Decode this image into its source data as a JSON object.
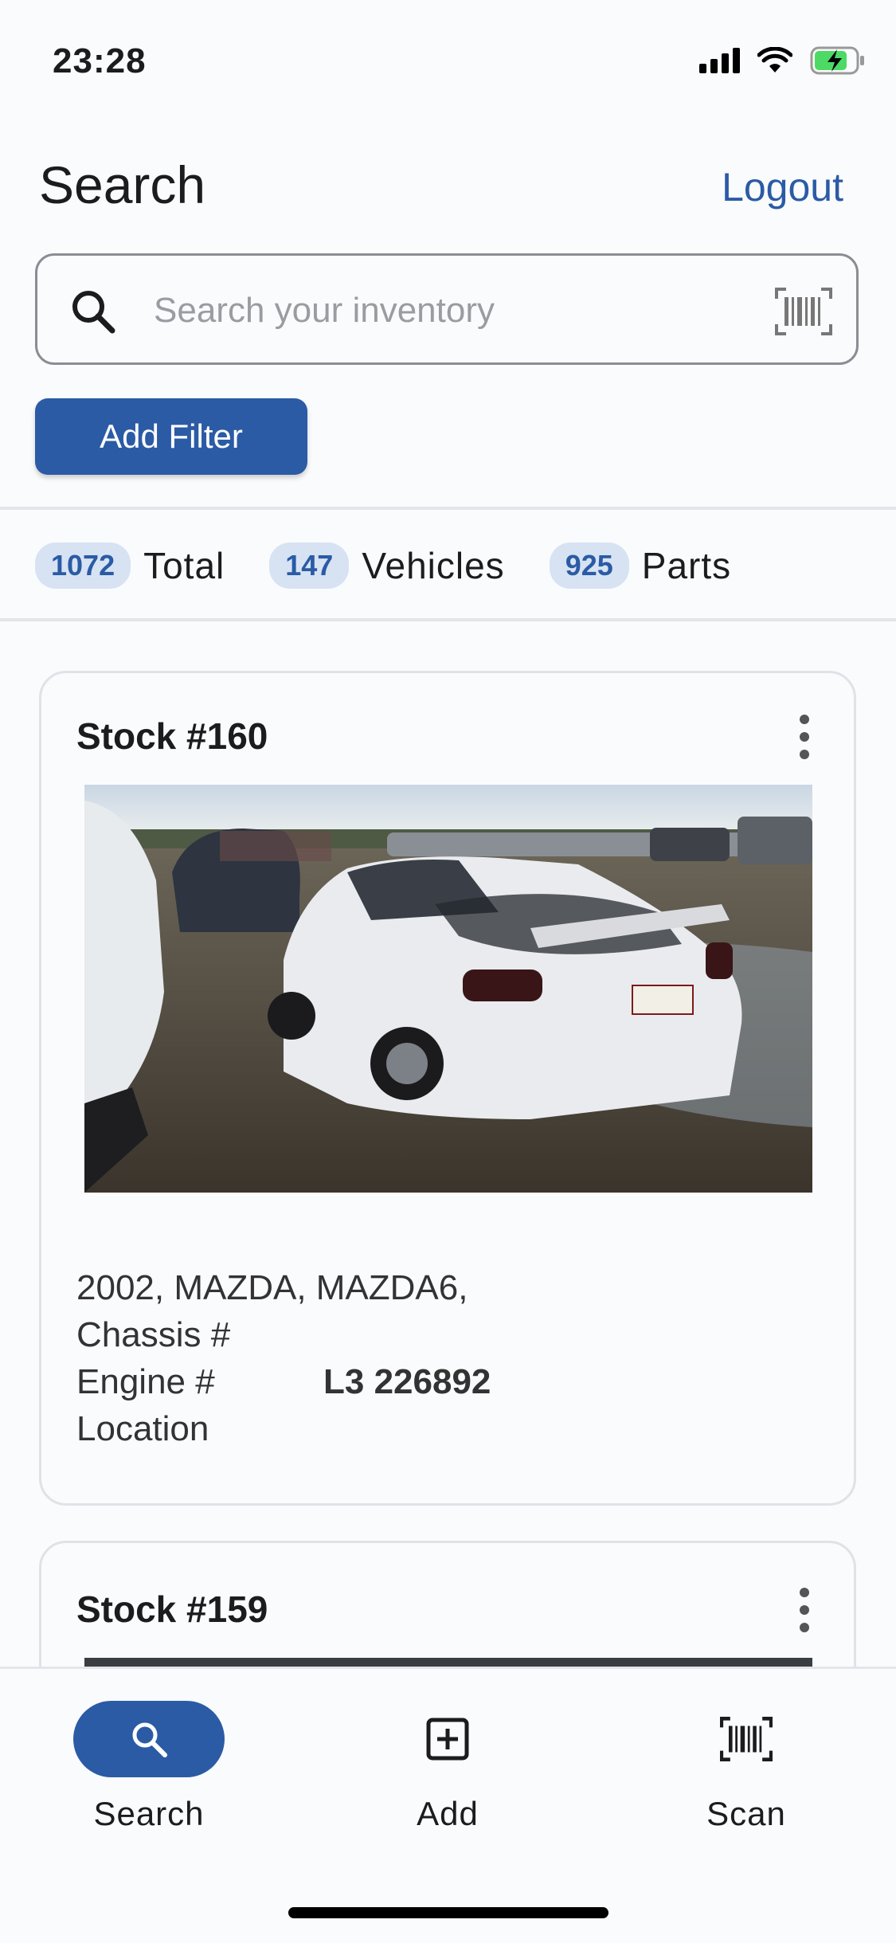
{
  "status_bar": {
    "time": "23:28"
  },
  "header": {
    "title": "Search",
    "logout_label": "Logout"
  },
  "search": {
    "placeholder": "Search your inventory",
    "value": ""
  },
  "filter": {
    "add_filter_label": "Add Filter"
  },
  "stats": [
    {
      "count": "1072",
      "label": "Total"
    },
    {
      "count": "147",
      "label": "Vehicles"
    },
    {
      "count": "925",
      "label": "Parts"
    }
  ],
  "cards": [
    {
      "title": "Stock #160",
      "summary": "2002, MAZDA, MAZDA6,",
      "chassis_label": "Chassis #",
      "chassis_value": "",
      "engine_label": "Engine #",
      "engine_value": "L3 226892",
      "location_label": "Location",
      "location_value": ""
    },
    {
      "title": "Stock #159"
    }
  ],
  "bottom_nav": [
    {
      "label": "Search",
      "icon": "search-icon",
      "active": true
    },
    {
      "label": "Add",
      "icon": "add-box-icon",
      "active": false
    },
    {
      "label": "Scan",
      "icon": "barcode-scan-icon",
      "active": false
    }
  ],
  "colors": {
    "accent": "#2c5ba5",
    "badge_bg": "#d7e3f3",
    "background": "#fafbfd"
  }
}
